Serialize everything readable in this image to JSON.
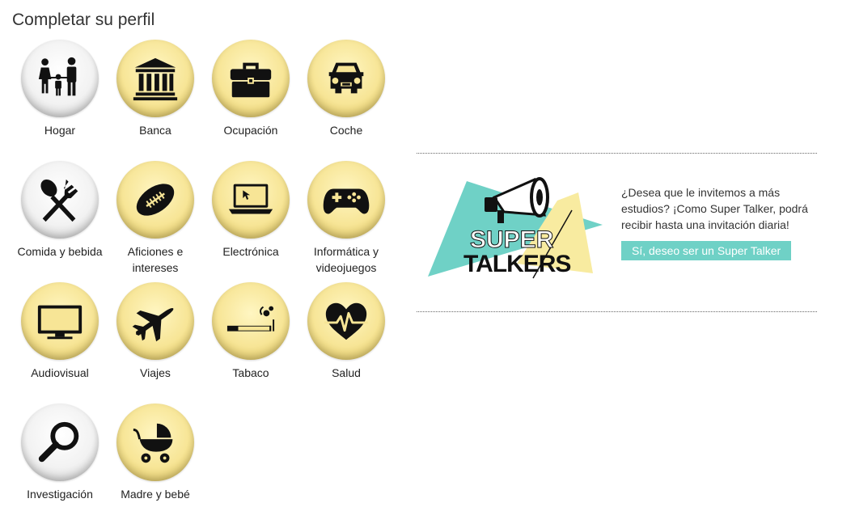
{
  "page_title": "Completar su perfil",
  "profile_items": [
    {
      "id": "hogar",
      "label": "Hogar",
      "icon": "family-icon",
      "state": "completed"
    },
    {
      "id": "banca",
      "label": "Banca",
      "icon": "bank-icon",
      "state": "pending"
    },
    {
      "id": "ocupacion",
      "label": "Ocupación",
      "icon": "briefcase-icon",
      "state": "pending"
    },
    {
      "id": "coche",
      "label": "Coche",
      "icon": "car-icon",
      "state": "pending"
    },
    {
      "id": "comida",
      "label": "Comida y bebida",
      "icon": "cutlery-icon",
      "state": "completed"
    },
    {
      "id": "aficiones",
      "label": "Aficiones e intereses",
      "icon": "football-icon",
      "state": "pending"
    },
    {
      "id": "electronica",
      "label": "Electrónica",
      "icon": "laptop-icon",
      "state": "pending"
    },
    {
      "id": "informatica",
      "label": "Informática y videojuegos",
      "icon": "gamepad-icon",
      "state": "pending"
    },
    {
      "id": "audiovisual",
      "label": "Audiovisual",
      "icon": "tv-icon",
      "state": "pending"
    },
    {
      "id": "viajes",
      "label": "Viajes",
      "icon": "airplane-icon",
      "state": "pending"
    },
    {
      "id": "tabaco",
      "label": "Tabaco",
      "icon": "cigarette-icon",
      "state": "pending"
    },
    {
      "id": "salud",
      "label": "Salud",
      "icon": "heart-pulse-icon",
      "state": "pending"
    },
    {
      "id": "investigacion",
      "label": "Investigación",
      "icon": "magnifier-icon",
      "state": "completed"
    },
    {
      "id": "madre",
      "label": "Madre y bebé",
      "icon": "baby-stroller-icon",
      "state": "pending"
    }
  ],
  "promo": {
    "logo_line1": "SUPER",
    "logo_line2": "TALKERS",
    "text": "¿Desea que le invitemos a más estudios? ¡Como Super Talker, podrá recibir hasta una invitación diaria!",
    "button_label": "Sí, deseo ser un Super Talker"
  },
  "colors": {
    "pending_circle": "#f7e596",
    "completed_circle": "#f2f2f2",
    "button": "#6fd1c6",
    "logo_teal": "#6fd1c6",
    "logo_yellow": "#f8eba0"
  }
}
